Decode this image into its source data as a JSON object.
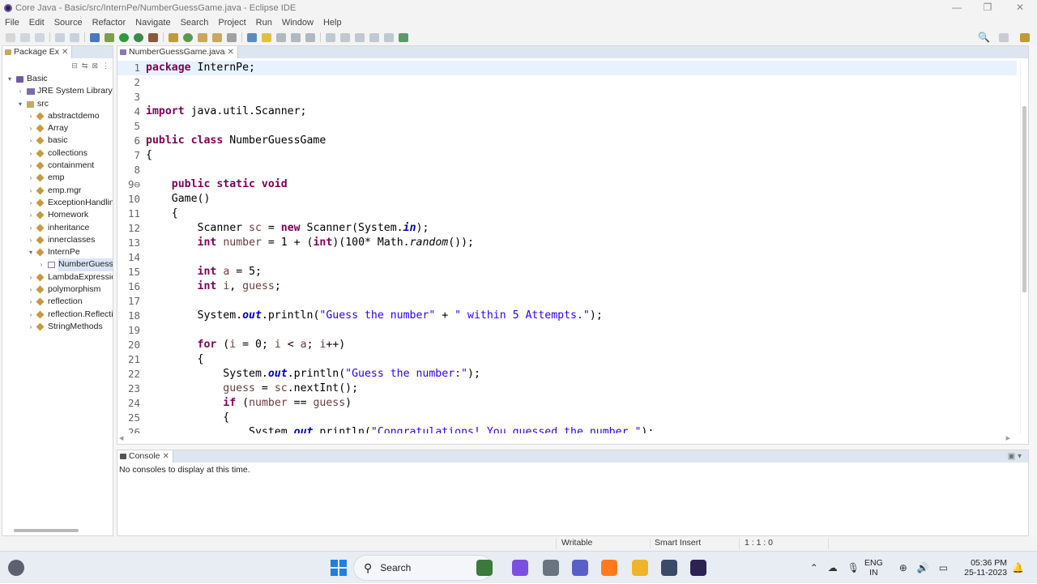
{
  "window": {
    "title": "Core Java - Basic/src/InternPe/NumberGuessGame.java - Eclipse IDE",
    "minimize_icon": "—",
    "maximize_icon": "❐",
    "close_icon": "✕"
  },
  "menu": [
    "File",
    "Edit",
    "Source",
    "Refactor",
    "Navigate",
    "Search",
    "Project",
    "Run",
    "Window",
    "Help"
  ],
  "package_explorer": {
    "tab_label": "Package Ex",
    "tree": [
      {
        "label": "Basic",
        "level": 0,
        "expanded": true,
        "icon": "project-icon"
      },
      {
        "label": "JRE System Library [Ja",
        "level": 1,
        "expanded": false,
        "icon": "library-icon"
      },
      {
        "label": "src",
        "level": 1,
        "expanded": true,
        "icon": "source-folder-icon"
      },
      {
        "label": "abstractdemo",
        "level": 2,
        "expanded": false,
        "icon": "package-icon"
      },
      {
        "label": "Array",
        "level": 2,
        "expanded": false,
        "icon": "package-icon"
      },
      {
        "label": "basic",
        "level": 2,
        "expanded": false,
        "icon": "package-icon"
      },
      {
        "label": "collections",
        "level": 2,
        "expanded": false,
        "icon": "package-icon"
      },
      {
        "label": "containment",
        "level": 2,
        "expanded": false,
        "icon": "package-icon"
      },
      {
        "label": "emp",
        "level": 2,
        "expanded": false,
        "icon": "package-icon"
      },
      {
        "label": "emp.mgr",
        "level": 2,
        "expanded": false,
        "icon": "package-icon"
      },
      {
        "label": "ExceptionHandlin",
        "level": 2,
        "expanded": false,
        "icon": "package-icon"
      },
      {
        "label": "Homework",
        "level": 2,
        "expanded": false,
        "icon": "package-icon"
      },
      {
        "label": "inheritance",
        "level": 2,
        "expanded": false,
        "icon": "package-icon"
      },
      {
        "label": "innerclasses",
        "level": 2,
        "expanded": false,
        "icon": "package-icon"
      },
      {
        "label": "InternPe",
        "level": 2,
        "expanded": true,
        "icon": "package-icon"
      },
      {
        "label": "NumberGuessG",
        "level": 3,
        "expanded": false,
        "icon": "java-file-icon",
        "selected": true
      },
      {
        "label": "LambdaExpression",
        "level": 2,
        "expanded": false,
        "icon": "package-icon"
      },
      {
        "label": "polymorphism",
        "level": 2,
        "expanded": false,
        "icon": "package-icon"
      },
      {
        "label": "reflection",
        "level": 2,
        "expanded": false,
        "icon": "package-icon"
      },
      {
        "label": "reflection.Reflectic",
        "level": 2,
        "expanded": false,
        "icon": "package-icon"
      },
      {
        "label": "StringMethods",
        "level": 2,
        "expanded": false,
        "icon": "package-icon"
      }
    ]
  },
  "editor": {
    "tab_label": "NumberGuessGame.java",
    "current_line": 1,
    "lines": [
      {
        "n": "1",
        "html": "<span class='kw'>package</span> InternPe;"
      },
      {
        "n": "2",
        "html": ""
      },
      {
        "n": "3",
        "html": ""
      },
      {
        "n": "4",
        "html": "<span class='kw'>import</span> java.util.Scanner;"
      },
      {
        "n": "5",
        "html": ""
      },
      {
        "n": "6",
        "html": "<span class='kw'>public class</span> NumberGuessGame"
      },
      {
        "n": "7",
        "html": "{"
      },
      {
        "n": "8",
        "html": ""
      },
      {
        "n": "9⊖",
        "html": "    <span class='kw'>public static void</span>"
      },
      {
        "n": "10",
        "html": "    Game()"
      },
      {
        "n": "11",
        "html": "    {"
      },
      {
        "n": "12",
        "html": "        Scanner <span class='vr'>sc</span> = <span class='kw'>new</span> Scanner(System.<span class='fld'>in</span>);"
      },
      {
        "n": "13",
        "html": "        <span class='kw'>int</span> <span class='vr'>number</span> = 1 + (<span class='kw'>int</span>)(100* Math.<span class='mt'>random</span>());"
      },
      {
        "n": "14",
        "html": ""
      },
      {
        "n": "15",
        "html": "        <span class='kw'>int</span> <span class='vr'>a</span> = 5;"
      },
      {
        "n": "16",
        "html": "        <span class='kw'>int</span> <span class='vr'>i</span>, <span class='vr'>guess</span>;"
      },
      {
        "n": "17",
        "html": ""
      },
      {
        "n": "18",
        "html": "        System.<span class='fld'>out</span>.println(<span class='st'>\"Guess the number\"</span> + <span class='st'>\" within 5 Attempts.\"</span>);"
      },
      {
        "n": "19",
        "html": ""
      },
      {
        "n": "20",
        "html": "        <span class='kw'>for</span> (<span class='vr'>i</span> = 0; <span class='vr'>i</span> &lt; <span class='vr'>a</span>; <span class='vr'>i</span>++)"
      },
      {
        "n": "21",
        "html": "        {"
      },
      {
        "n": "22",
        "html": "            System.<span class='fld'>out</span>.println(<span class='st'>\"Guess the number:\"</span>);"
      },
      {
        "n": "23",
        "html": "            <span class='vr'>guess</span> = <span class='vr'>sc</span>.nextInt();"
      },
      {
        "n": "24",
        "html": "            <span class='kw'>if</span> (<span class='vr'>number</span> == <span class='vr'>guess</span>)"
      },
      {
        "n": "25",
        "html": "            {"
      },
      {
        "n": "26",
        "html": "                System.<span class='fld'>out</span>.println(<span class='st'>\"Congratulations! You guessed the number.\"</span>);"
      }
    ]
  },
  "console": {
    "tab_label": "Console",
    "message": "No consoles to display at this time."
  },
  "status": {
    "writable": "Writable",
    "insert_mode": "Smart Insert",
    "position": "1 : 1 : 0"
  },
  "taskbar": {
    "search_placeholder": "Search",
    "language_top": "ENG",
    "language_bottom": "IN",
    "time": "05:36 PM",
    "date": "25-11-2023",
    "apps": [
      {
        "name": "chess-app-icon",
        "color": "#3a7a3a"
      },
      {
        "name": "copilot-icon",
        "color": "#7b4ee0"
      },
      {
        "name": "task-view-icon",
        "color": "#6a7480"
      },
      {
        "name": "teams-icon",
        "color": "#5a5fc8"
      },
      {
        "name": "firefox-icon",
        "color": "#ff7a1a"
      },
      {
        "name": "file-explorer-icon",
        "color": "#f0b429"
      },
      {
        "name": "terminal-icon",
        "color": "#3a4a6a"
      },
      {
        "name": "eclipse-icon",
        "color": "#2c2255"
      }
    ]
  }
}
